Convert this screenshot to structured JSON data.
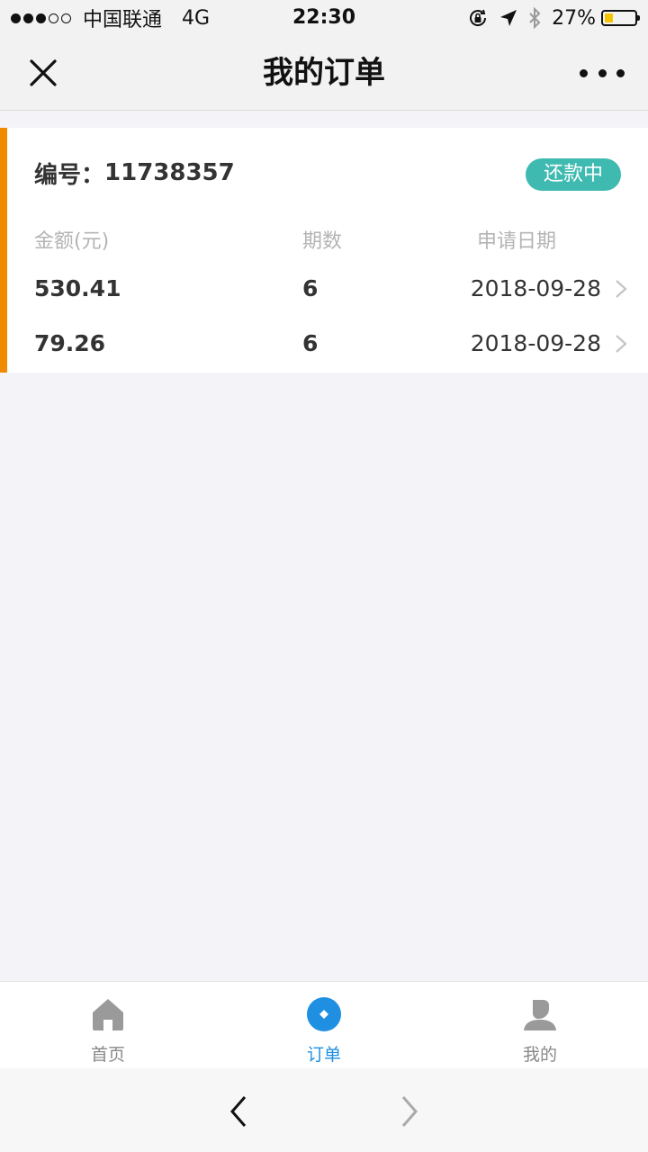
{
  "status_bar": {
    "carrier": "中国联通",
    "network": "4G",
    "time": "22:30",
    "battery_percent": "27%",
    "battery_level": 0.27,
    "signal_strength": 3,
    "signal_max": 5,
    "icons": [
      "orientation-lock-icon",
      "location-arrow-icon",
      "bluetooth-icon",
      "battery-icon"
    ]
  },
  "nav": {
    "title": "我的订单",
    "close_icon": "close-icon",
    "more_icon": "more-icon"
  },
  "order": {
    "id_label": "编号：",
    "id_value": "11738357",
    "status": "还款中",
    "accent_color": "#f08a00",
    "status_color": "#3fbab0",
    "columns": [
      "金额(元)",
      "期数",
      "申请日期"
    ],
    "rows": [
      {
        "amount": "530.41",
        "periods": "6",
        "date": "2018-09-28"
      },
      {
        "amount": "79.26",
        "periods": "6",
        "date": "2018-09-28"
      }
    ]
  },
  "tabbar": {
    "active_color": "#1e8fe1",
    "items": [
      {
        "label": "首页",
        "icon": "home-icon"
      },
      {
        "label": "订单",
        "icon": "order-icon"
      },
      {
        "label": "我的",
        "icon": "user-icon"
      }
    ]
  },
  "browser": {
    "back_icon": "back-arrow-icon",
    "forward_icon": "forward-arrow-icon"
  }
}
